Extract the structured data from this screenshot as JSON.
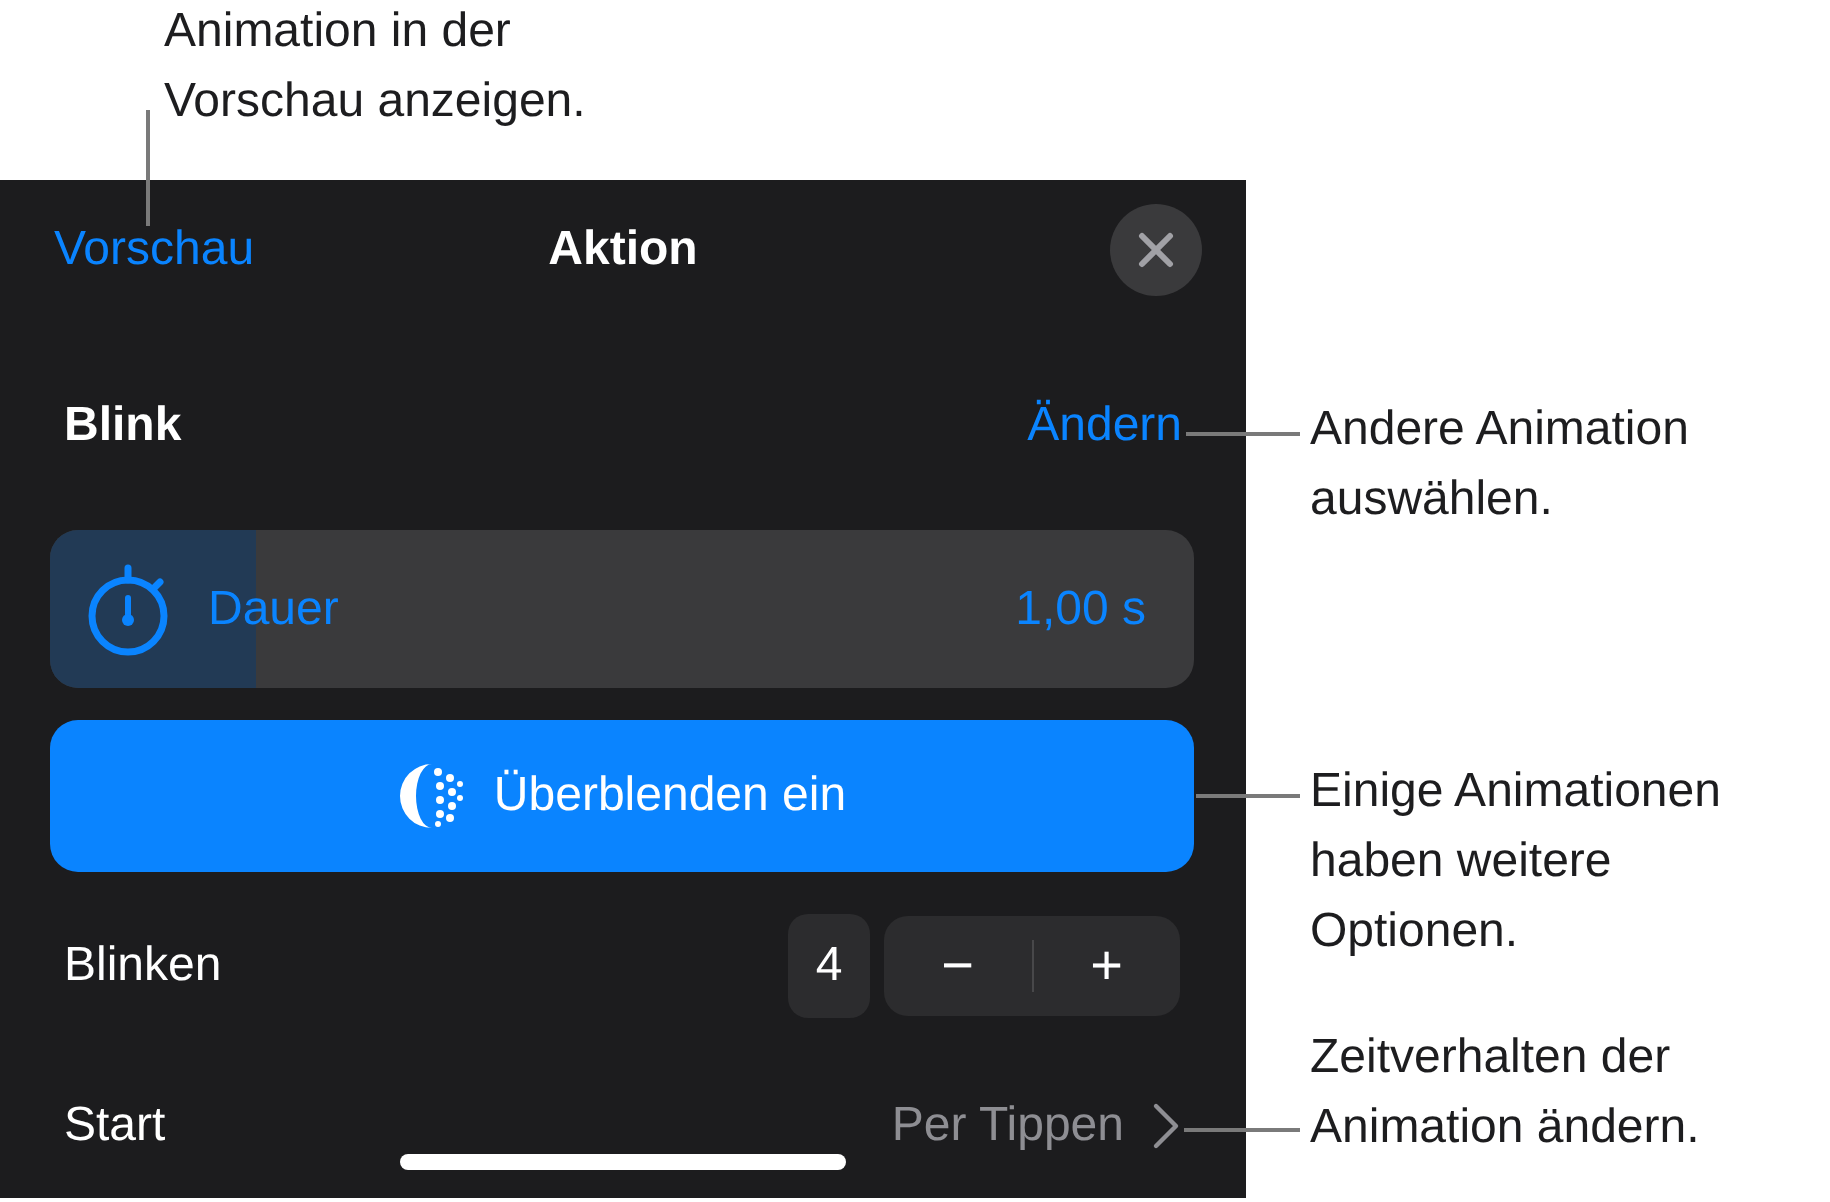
{
  "top_callout": "Animation in der\nVorschau anzeigen.",
  "header": {
    "preview_link": "Vorschau",
    "title": "Aktion"
  },
  "animation": {
    "name": "Blink",
    "change_link": "Ändern",
    "callout": "Andere Animation\nauswählen."
  },
  "duration": {
    "label": "Dauer",
    "value": "1,00 s",
    "level": 0.18
  },
  "effect_button": {
    "label": "Überblenden ein",
    "callout": "Einige Animationen\nhaben weitere\nOptionen."
  },
  "blinks": {
    "label": "Blinken",
    "count": "4",
    "minus": "−",
    "plus": "+"
  },
  "start": {
    "label": "Start",
    "value": "Per Tippen",
    "callout": "Zeitverhalten der\nAnimation ändern."
  }
}
